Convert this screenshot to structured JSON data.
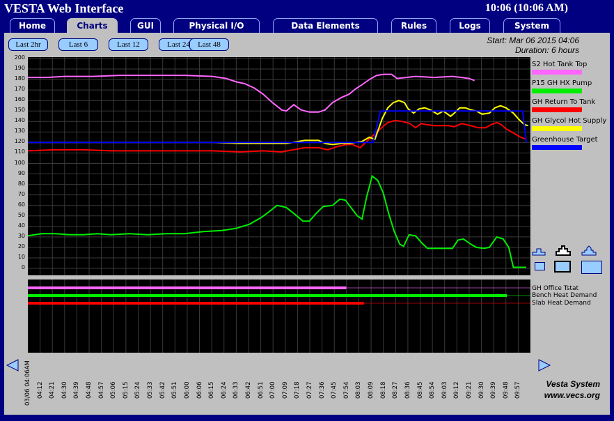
{
  "header": {
    "title": "VESTA Web Interface",
    "time": "10:06 (10:06 AM)"
  },
  "tabs": [
    {
      "label": "Home",
      "active": false
    },
    {
      "label": "Charts",
      "active": true
    },
    {
      "label": "GUI",
      "active": false
    },
    {
      "label": "Physical I/O",
      "active": false
    },
    {
      "label": "Data Elements",
      "active": false
    },
    {
      "label": "Rules",
      "active": false
    },
    {
      "label": "Logs",
      "active": false
    },
    {
      "label": "System",
      "active": false
    }
  ],
  "range_buttons": [
    "Last 2hr",
    "Last 6",
    "Last 12",
    "Last 24",
    "Last 48"
  ],
  "selected_range": "Last 6",
  "info": {
    "start": "Start: Mar 06 2015 04:06",
    "duration": "Duration: 6 hours"
  },
  "chart_data": {
    "type": "line",
    "ylim": [
      0,
      200
    ],
    "y_ticks": [
      200,
      190,
      180,
      170,
      160,
      150,
      140,
      130,
      120,
      110,
      100,
      90,
      80,
      70,
      60,
      50,
      40,
      30,
      20,
      10,
      0
    ],
    "x_date_label": "03/06 04:06AM",
    "x_ticks": [
      "04:12",
      "04:21",
      "04:30",
      "04:39",
      "04:48",
      "04:57",
      "05:06",
      "05:15",
      "05:24",
      "05:33",
      "05:42",
      "05:51",
      "06:00",
      "06:06",
      "06:15",
      "06:24",
      "06:33",
      "06:42",
      "06:51",
      "07:00",
      "07:09",
      "07:18",
      "07:27",
      "07:36",
      "07:45",
      "07:54",
      "08:03",
      "08:09",
      "08:18",
      "08:27",
      "08:36",
      "08:45",
      "08:54",
      "09:03",
      "09:12",
      "09:21",
      "09:30",
      "09:39",
      "09:48",
      "09:57"
    ],
    "x_minutes_range": [
      0,
      360
    ],
    "grid": true,
    "legend_position": "right",
    "series": [
      {
        "name": "S2 Hot Tank Top",
        "color": "#ff66ff",
        "points": [
          [
            0,
            182
          ],
          [
            20,
            182
          ],
          [
            40,
            183
          ],
          [
            70,
            183
          ],
          [
            100,
            184
          ],
          [
            140,
            184
          ],
          [
            170,
            184
          ],
          [
            200,
            183
          ],
          [
            215,
            181
          ],
          [
            225,
            178
          ],
          [
            235,
            176
          ],
          [
            245,
            172
          ],
          [
            255,
            166
          ],
          [
            265,
            158
          ],
          [
            275,
            151
          ],
          [
            280,
            150
          ],
          [
            288,
            156
          ],
          [
            296,
            151
          ],
          [
            305,
            149
          ],
          [
            315,
            149
          ],
          [
            322,
            151
          ],
          [
            330,
            158
          ],
          [
            340,
            163
          ],
          [
            348,
            166
          ],
          [
            355,
            171
          ],
          [
            362,
            175
          ],
          [
            370,
            180
          ],
          [
            378,
            184
          ],
          [
            386,
            185
          ],
          [
            394,
            185
          ],
          [
            400,
            181
          ],
          [
            410,
            182
          ],
          [
            420,
            183
          ],
          [
            440,
            182
          ],
          [
            460,
            183
          ],
          [
            470,
            182
          ],
          [
            478,
            181
          ],
          [
            484,
            179
          ]
        ]
      },
      {
        "name": "P15 GH HX Pump",
        "color": "#00ee00",
        "points": [
          [
            0,
            31
          ],
          [
            15,
            33
          ],
          [
            30,
            33
          ],
          [
            45,
            32
          ],
          [
            60,
            32
          ],
          [
            75,
            33
          ],
          [
            90,
            32
          ],
          [
            110,
            33
          ],
          [
            130,
            32
          ],
          [
            150,
            33
          ],
          [
            170,
            33
          ],
          [
            190,
            35
          ],
          [
            210,
            36
          ],
          [
            225,
            38
          ],
          [
            240,
            42
          ],
          [
            252,
            48
          ],
          [
            260,
            53
          ],
          [
            270,
            60
          ],
          [
            280,
            58
          ],
          [
            290,
            51
          ],
          [
            298,
            45
          ],
          [
            305,
            45
          ],
          [
            312,
            52
          ],
          [
            320,
            59
          ],
          [
            330,
            60
          ],
          [
            338,
            66
          ],
          [
            344,
            65
          ],
          [
            350,
            58
          ],
          [
            357,
            50
          ],
          [
            362,
            47
          ],
          [
            367,
            68
          ],
          [
            373,
            88
          ],
          [
            379,
            84
          ],
          [
            385,
            72
          ],
          [
            391,
            52
          ],
          [
            397,
            35
          ],
          [
            403,
            23
          ],
          [
            407,
            21
          ],
          [
            413,
            32
          ],
          [
            420,
            31
          ],
          [
            427,
            24
          ],
          [
            433,
            19
          ],
          [
            445,
            19
          ],
          [
            460,
            19
          ],
          [
            466,
            27
          ],
          [
            472,
            28
          ],
          [
            480,
            23
          ],
          [
            486,
            20
          ],
          [
            494,
            19
          ],
          [
            500,
            20
          ],
          [
            508,
            30
          ],
          [
            515,
            28
          ],
          [
            521,
            20
          ],
          [
            526,
            1
          ],
          [
            540,
            1
          ]
        ]
      },
      {
        "name": "GH Return To Tank",
        "color": "#ff0000",
        "points": [
          [
            0,
            112
          ],
          [
            30,
            113
          ],
          [
            60,
            113
          ],
          [
            90,
            112
          ],
          [
            120,
            112
          ],
          [
            160,
            112
          ],
          [
            200,
            112
          ],
          [
            230,
            111
          ],
          [
            255,
            112
          ],
          [
            275,
            111
          ],
          [
            300,
            115
          ],
          [
            315,
            115
          ],
          [
            325,
            113
          ],
          [
            335,
            116
          ],
          [
            345,
            118
          ],
          [
            352,
            118
          ],
          [
            360,
            115
          ],
          [
            372,
            125
          ],
          [
            382,
            133
          ],
          [
            390,
            139
          ],
          [
            398,
            141
          ],
          [
            406,
            140
          ],
          [
            414,
            138
          ],
          [
            420,
            134
          ],
          [
            426,
            138
          ],
          [
            432,
            137
          ],
          [
            440,
            136
          ],
          [
            446,
            136
          ],
          [
            456,
            136
          ],
          [
            462,
            135
          ],
          [
            470,
            138
          ],
          [
            480,
            136
          ],
          [
            488,
            134
          ],
          [
            496,
            134
          ],
          [
            502,
            137
          ],
          [
            508,
            139
          ],
          [
            513,
            137
          ],
          [
            518,
            133
          ],
          [
            524,
            130
          ],
          [
            528,
            128
          ],
          [
            534,
            125
          ],
          [
            540,
            123
          ]
        ]
      },
      {
        "name": "GH Glycol Hot Supply",
        "color": "#ffff00",
        "points": [
          [
            0,
            120
          ],
          [
            40,
            120
          ],
          [
            80,
            120
          ],
          [
            120,
            120
          ],
          [
            160,
            120
          ],
          [
            200,
            120
          ],
          [
            230,
            119
          ],
          [
            260,
            119
          ],
          [
            280,
            119
          ],
          [
            300,
            122
          ],
          [
            315,
            122
          ],
          [
            322,
            119
          ],
          [
            330,
            118
          ],
          [
            340,
            119
          ],
          [
            348,
            119
          ],
          [
            355,
            120
          ],
          [
            362,
            121
          ],
          [
            370,
            125
          ],
          [
            376,
            123
          ],
          [
            384,
            143
          ],
          [
            390,
            153
          ],
          [
            396,
            158
          ],
          [
            402,
            160
          ],
          [
            408,
            158
          ],
          [
            412,
            152
          ],
          [
            418,
            148
          ],
          [
            424,
            152
          ],
          [
            430,
            153
          ],
          [
            436,
            151
          ],
          [
            444,
            147
          ],
          [
            450,
            150
          ],
          [
            458,
            145
          ],
          [
            462,
            148
          ],
          [
            468,
            153
          ],
          [
            474,
            153
          ],
          [
            480,
            151
          ],
          [
            486,
            150
          ],
          [
            492,
            147
          ],
          [
            500,
            148
          ],
          [
            506,
            153
          ],
          [
            512,
            155
          ],
          [
            518,
            153
          ],
          [
            526,
            148
          ],
          [
            532,
            142
          ],
          [
            538,
            137
          ],
          [
            542,
            136
          ]
        ]
      },
      {
        "name": "Greenhouse Target",
        "color": "#0000ff",
        "points": [
          [
            0,
            120
          ],
          [
            85,
            120
          ],
          [
            150,
            120
          ],
          [
            200,
            120
          ],
          [
            260,
            120
          ],
          [
            300,
            120
          ],
          [
            330,
            120
          ],
          [
            374,
            120
          ],
          [
            382,
            150
          ],
          [
            470,
            150
          ],
          [
            520,
            150
          ],
          [
            536,
            150
          ],
          [
            540,
            120
          ]
        ]
      }
    ]
  },
  "controls": [
    {
      "name": "zoom-in-small",
      "icon": "small-step-up-icon"
    },
    {
      "name": "zoom-in-medium",
      "icon": "medium-step-up-icon"
    },
    {
      "name": "zoom-in-large",
      "icon": "large-step-up-icon"
    },
    {
      "name": "size-small",
      "icon": "small-box-icon"
    },
    {
      "name": "size-medium",
      "icon": "medium-box-icon"
    },
    {
      "name": "size-large",
      "icon": "large-box-icon"
    }
  ],
  "digital_signals": [
    {
      "name": "GH Office Tstat",
      "color": "#ff66ff",
      "on_until_min": 345
    },
    {
      "name": "Bench Heat Demand",
      "color": "#00ee00",
      "on_until_min": 519
    },
    {
      "name": "Slab Heat Demand",
      "color": "#ff0000",
      "on_until_min": 364
    }
  ],
  "footer": {
    "line1": "Vesta System",
    "line2": "www.vecs.org"
  }
}
